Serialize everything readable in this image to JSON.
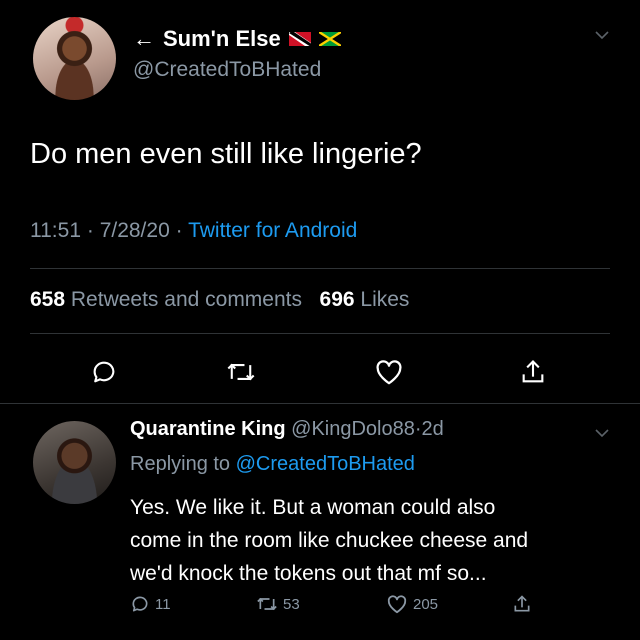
{
  "tweet": {
    "display_name": "Sum'n Else",
    "back_arrow": "←",
    "flags": [
      "trinidad-tobago-flag",
      "jamaica-flag"
    ],
    "handle": "@CreatedToBHated",
    "text": "Do men even still like lingerie?",
    "time": "11:51",
    "date": "7/28/20",
    "separator": "·",
    "source": "Twitter for Android",
    "retweets_count": "658",
    "retweets_label": "Retweets and comments",
    "likes_count": "696",
    "likes_label": "Likes",
    "actions": [
      "reply-icon",
      "retweet-icon",
      "like-icon",
      "share-icon"
    ]
  },
  "reply": {
    "display_name": "Quarantine King",
    "handle": "@KingDolo88",
    "separator": "·",
    "age": "2d",
    "replying_prefix": "Replying to",
    "replying_to": "@CreatedToBHated",
    "lines": [
      "Yes. We like it. But a woman could also",
      "come in the room like chuckee cheese and",
      "we'd knock the tokens out that mf so..."
    ],
    "reply_count": "11",
    "retweet_count": "53",
    "like_count": "205"
  },
  "colors": {
    "background": "#000000",
    "primary_text": "#ffffff",
    "secondary_text": "#8b98a5",
    "accent": "#1d9bf0",
    "divider": "#2f3336"
  }
}
